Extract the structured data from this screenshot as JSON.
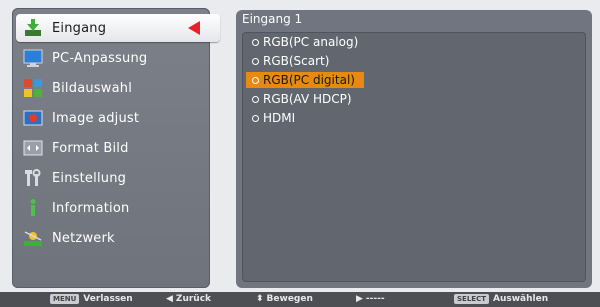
{
  "menu": {
    "items": [
      {
        "label": "Eingang",
        "icon": "input-arrow-icon",
        "active": true
      },
      {
        "label": "PC-Anpassung",
        "icon": "monitor-icon"
      },
      {
        "label": "Bildauswahl",
        "icon": "picture-select-icon"
      },
      {
        "label": "Image adjust",
        "icon": "image-adjust-icon"
      },
      {
        "label": "Format Bild",
        "icon": "screen-format-icon"
      },
      {
        "label": "Einstellung",
        "icon": "settings-tools-icon"
      },
      {
        "label": "Information",
        "icon": "info-icon"
      },
      {
        "label": "Netzwerk",
        "icon": "network-icon"
      }
    ]
  },
  "panel": {
    "title": "Eingang 1",
    "options": [
      {
        "label": "RGB(PC analog)"
      },
      {
        "label": "RGB(Scart)"
      },
      {
        "label": "RGB(PC digital)",
        "selected": true
      },
      {
        "label": "RGB(AV HDCP)"
      },
      {
        "label": "HDMI"
      }
    ]
  },
  "footer": {
    "menu_key": "MENU",
    "exit": "Verlassen",
    "back_arrow": "◀",
    "back": "Zurück",
    "move_arrow": "⬍",
    "move": "Bewegen",
    "next_arrow": "▶",
    "next": "-----",
    "select_key": "SELECT",
    "select": "Auswählen"
  },
  "colors": {
    "selected_option": "#e88a12",
    "active_marker": "#e8202a"
  }
}
